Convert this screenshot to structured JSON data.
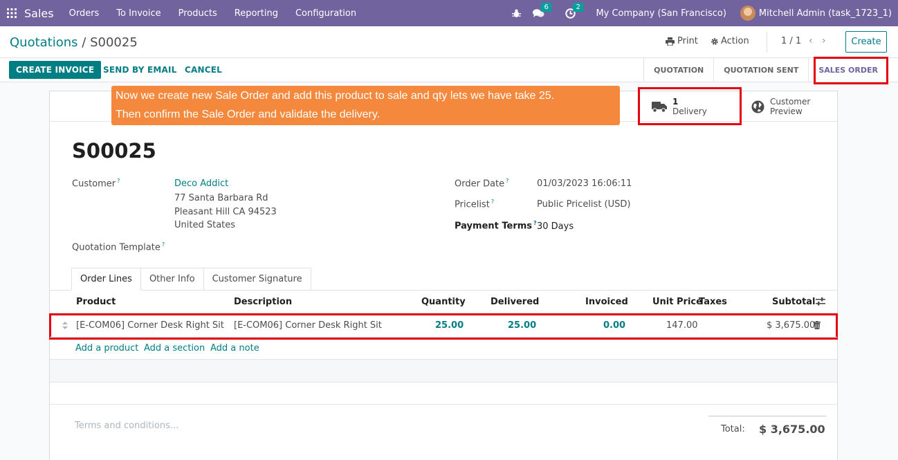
{
  "navbar": {
    "app_name": "Sales",
    "menu": [
      "Orders",
      "To Invoice",
      "Products",
      "Reporting",
      "Configuration"
    ],
    "messages_count": "6",
    "activities_count": "2",
    "company": "My Company (San Francisco)",
    "user": "Mitchell Admin (task_1723_1)"
  },
  "control_panel": {
    "breadcrumb_parent": "Quotations",
    "breadcrumb_separator": "/",
    "breadcrumb_current": "S00025",
    "print_label": "Print",
    "action_label": "Action",
    "pager": "1 / 1",
    "prev": "‹",
    "next": "›",
    "create_label": "Create"
  },
  "statusbar": {
    "create_invoice": "CREATE INVOICE",
    "send_by_email": "SEND BY EMAIL",
    "cancel": "CANCEL",
    "stages": [
      "QUOTATION",
      "QUOTATION SENT",
      "SALES ORDER"
    ],
    "active_stage": "SALES ORDER"
  },
  "smart_buttons": {
    "delivery_count": "1",
    "delivery_label": "Delivery",
    "preview_line1": "Customer",
    "preview_line2": "Preview"
  },
  "callout": {
    "line1": "Now we create new Sale Order and add this product to sale and qty lets we have take 25.",
    "line2": "Then confirm the Sale Order and validate the delivery."
  },
  "form": {
    "title": "S00025",
    "customer_label": "Customer",
    "customer_name": "Deco Addict",
    "address_line1": "77 Santa Barbara Rd",
    "address_line2": "Pleasant Hill CA 94523",
    "address_line3": "United States",
    "quotation_template_label": "Quotation Template",
    "order_date_label": "Order Date",
    "order_date": "01/03/2023 16:06:11",
    "pricelist_label": "Pricelist",
    "pricelist": "Public Pricelist (USD)",
    "payment_terms_label": "Payment Terms",
    "payment_terms": "30 Days",
    "help_mark": "?"
  },
  "tabs": [
    "Order Lines",
    "Other Info",
    "Customer Signature"
  ],
  "order_lines": {
    "headers": {
      "product": "Product",
      "description": "Description",
      "quantity": "Quantity",
      "delivered": "Delivered",
      "invoiced": "Invoiced",
      "unit_price": "Unit Price",
      "taxes": "Taxes",
      "subtotal": "Subtotal"
    },
    "rows": [
      {
        "product": "[E-COM06] Corner Desk Right Sit",
        "description": "[E-COM06] Corner Desk Right Sit",
        "quantity": "25.00",
        "delivered": "25.00",
        "invoiced": "0.00",
        "unit_price": "147.00",
        "taxes": "",
        "subtotal": "$ 3,675.00"
      }
    ],
    "add_product": "Add a product",
    "add_section": "Add a section",
    "add_note": "Add a note"
  },
  "footer": {
    "terms_placeholder": "Terms and conditions...",
    "total_label": "Total:",
    "total_value": "$ 3,675.00"
  },
  "colors": {
    "navbar": "#71639e",
    "primary": "#017e84",
    "highlight": "#e3000f",
    "callout": "#f4883d"
  }
}
